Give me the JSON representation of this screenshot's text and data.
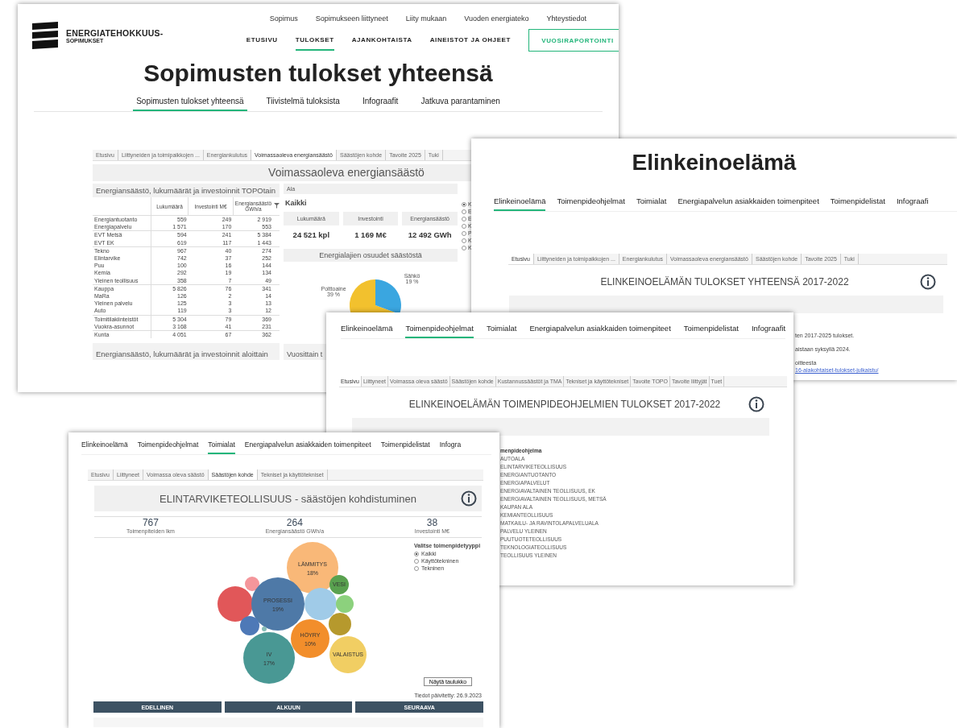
{
  "results_page": {
    "logo": {
      "line1": "ENERGIATEHOKKUUS-",
      "line2": "SOPIMUKSET"
    },
    "top_links": [
      "Sopimus",
      "Sopimukseen liittyneet",
      "Liity mukaan",
      "Vuoden energiateko",
      "Yhteystiedot"
    ],
    "main_nav": [
      {
        "label": "ETUSIVU",
        "selected": false
      },
      {
        "label": "TULOKSET",
        "selected": true
      },
      {
        "label": "AJANKOHTAISTA",
        "selected": false
      },
      {
        "label": "AINEISTOT JA OHJEET",
        "selected": false
      }
    ],
    "report_button": "VUOSIRAPORTOINTI",
    "title": "Sopimusten tulokset yhteensä",
    "sub_tabs": [
      {
        "label": "Sopimusten tulokset yhteensä",
        "selected": true
      },
      {
        "label": "Tiivistelmä tuloksista",
        "selected": false
      },
      {
        "label": "Infograafit",
        "selected": false
      },
      {
        "label": "Jatkuva parantaminen",
        "selected": false
      }
    ],
    "dashboard": {
      "tabs": [
        {
          "label": "Etusivu",
          "selected": false
        },
        {
          "label": "Liittyneiden ja toimipaikkojen ...",
          "selected": false
        },
        {
          "label": "Energiankulutus",
          "selected": false
        },
        {
          "label": "Voimassaoleva energiansäästö",
          "selected": true
        },
        {
          "label": "Säästöjen kohde",
          "selected": false
        },
        {
          "label": "Tavoite 2025",
          "selected": false
        },
        {
          "label": "Tuki",
          "selected": false
        }
      ],
      "title": "Voimassaoleva energiansäästö",
      "table": {
        "title": "Energiansäästö, lukumäärät ja investoinnit TOPOtain",
        "columns": [
          "Lukumäärä",
          "Investointi M€",
          "Energiansäästö GWh/a"
        ],
        "groups": [
          [
            {
              "name": "Energiantuotanto",
              "values": [
                "559",
                "249",
                "2 919"
              ]
            },
            {
              "name": "Energiapalvelu",
              "values": [
                "1 571",
                "170",
                "553"
              ]
            }
          ],
          [
            {
              "name": "EVT Metsä",
              "values": [
                "594",
                "241",
                "5 384"
              ]
            },
            {
              "name": "EVT EK",
              "values": [
                "619",
                "117",
                "1 443"
              ]
            }
          ],
          [
            {
              "name": "Tekno",
              "values": [
                "967",
                "40",
                "274"
              ]
            },
            {
              "name": "Elintarvike",
              "values": [
                "742",
                "37",
                "252"
              ]
            },
            {
              "name": "Puu",
              "values": [
                "100",
                "16",
                "144"
              ]
            },
            {
              "name": "Kemia",
              "values": [
                "292",
                "19",
                "134"
              ]
            },
            {
              "name": "Yleinen teollisuus",
              "values": [
                "358",
                "7",
                "49"
              ]
            }
          ],
          [
            {
              "name": "Kauppa",
              "values": [
                "5 826",
                "76",
                "341"
              ]
            },
            {
              "name": "MaRa",
              "values": [
                "126",
                "2",
                "14"
              ]
            },
            {
              "name": "Yleinen palvelu",
              "values": [
                "125",
                "3",
                "13"
              ]
            },
            {
              "name": "Auto",
              "values": [
                "119",
                "3",
                "12"
              ]
            }
          ],
          [
            {
              "name": "Toimitilakiinteistöt",
              "values": [
                "5 304",
                "79",
                "369"
              ]
            },
            {
              "name": "Vuokra-asunnot",
              "values": [
                "3 168",
                "41",
                "231"
              ]
            }
          ],
          [
            {
              "name": "Kunta",
              "values": [
                "4 051",
                "67",
                "362"
              ]
            }
          ]
        ]
      },
      "filter_label": "Ala",
      "filter_value": "Kaikki",
      "kpis": [
        {
          "label": "Lukumäärä",
          "value": "24 521 kpl"
        },
        {
          "label": "Investointi",
          "value": "1 169 M€"
        },
        {
          "label": "Energiansäästö",
          "value": "12 492 GWh"
        }
      ],
      "share_title": "Energialajien osuudet säästöstä",
      "shares": [
        {
          "label": "Polttoaine",
          "pct": "39 %",
          "color": "#f2c12e"
        },
        {
          "label": "Sähkö",
          "pct": "19 %",
          "color": "#3aa6e0"
        }
      ],
      "radios": [
        {
          "label": "K",
          "selected": true
        },
        {
          "label": "E",
          "selected": false
        },
        {
          "label": "E",
          "selected": false
        },
        {
          "label": "K",
          "selected": false
        },
        {
          "label": "P",
          "selected": false
        },
        {
          "label": "K",
          "selected": false
        },
        {
          "label": "K",
          "selected": false
        }
      ],
      "bottom_titles": [
        "Energiansäästö, lukumäärät ja investoinnit aloittain",
        "Vuosittain t"
      ]
    }
  },
  "business_page": {
    "title": "Elinkeinoelämä",
    "tabs": [
      {
        "label": "Elinkeinoelämä",
        "selected": true
      },
      {
        "label": "Toimenpideohjelmat",
        "selected": false
      },
      {
        "label": "Toimialat",
        "selected": false
      },
      {
        "label": "Energiapalvelun asiakkaiden toimenpiteet",
        "selected": false
      },
      {
        "label": "Toimenpidelistat",
        "selected": false
      },
      {
        "label": "Infograafi",
        "selected": false
      }
    ],
    "dashboard_tabs": [
      {
        "label": "Etusivu",
        "selected": true
      },
      {
        "label": "Liittyneiden ja toimipaikkojen ...",
        "selected": false
      },
      {
        "label": "Energiankulutus",
        "selected": false
      },
      {
        "label": "Voimassaoleva energiansäästö",
        "selected": false
      },
      {
        "label": "Säästöjen kohde",
        "selected": false
      },
      {
        "label": "Tavoite 2025",
        "selected": false
      },
      {
        "label": "Tuki",
        "selected": false
      }
    ],
    "dashboard_title": "ELINKEINOELÄMÄN TULOKSET YHTEENSÄ 2017-2022",
    "text_fragments": [
      "ten 2017-2025 tulokset.",
      "aistaan syksyllä 2024.",
      "oitteesta"
    ],
    "link_fragment": "16-alakohtaiset-tulokset-julkaistu/"
  },
  "programs_page": {
    "tabs": [
      {
        "label": "Elinkeinoelämä",
        "selected": false
      },
      {
        "label": "Toimenpideohjelmat",
        "selected": true
      },
      {
        "label": "Toimialat",
        "selected": false
      },
      {
        "label": "Energiapalvelun asiakkaiden toimenpiteet",
        "selected": false
      },
      {
        "label": "Toimenpidelistat",
        "selected": false
      },
      {
        "label": "Infograafit",
        "selected": false
      }
    ],
    "dashboard_tabs": [
      {
        "label": "Etusivu",
        "selected": true
      },
      {
        "label": "Liittyneet",
        "selected": false
      },
      {
        "label": "Voimassa oleva säästö",
        "selected": false
      },
      {
        "label": "Säästöjen kohde",
        "selected": false
      },
      {
        "label": "Kustannussäästöt ja TMA",
        "selected": false
      },
      {
        "label": "Tekniset ja käyttötekniset",
        "selected": false
      },
      {
        "label": "Tavoite TOPO",
        "selected": false
      },
      {
        "label": "Tavoite liittyjät",
        "selected": false
      },
      {
        "label": "Tuet",
        "selected": false
      }
    ],
    "dashboard_title": "ELINKEINOELÄMÄN TOIMENPIDEOHJELMIEN TULOKSET 2017-2022",
    "list_heading": "menpideohjelma",
    "programs": [
      "AUTOALA",
      "ELINTARVIKETEOLLISUUS",
      "ENERGIANTUOTANTO",
      "ENERGIAPALVELUT",
      "ENERGIAVALTAINEN TEOLLISUUS, EK",
      "ENERGIAVALTAINEN TEOLLISUUS, METSÄ",
      "KAUPAN ALA",
      "KEMIANTEOLLISUUS",
      "MATKAILU- JA RAVINTOLAPALVELUALA",
      "PALVELU YLEINEN",
      "PUUTUOTETEOLLISUUS",
      "TEKNOLOGIATEOLLISUUS",
      "TEOLLISUUS YLEINEN"
    ]
  },
  "food_industry_page": {
    "tabs": [
      {
        "label": "Elinkeinoelämä",
        "selected": false
      },
      {
        "label": "Toimenpideohjelmat",
        "selected": false
      },
      {
        "label": "Toimialat",
        "selected": true
      },
      {
        "label": "Energiapalvelun asiakkaiden toimenpiteet",
        "selected": false
      },
      {
        "label": "Toimenpidelistat",
        "selected": false
      },
      {
        "label": "Infogra",
        "selected": false
      }
    ],
    "dashboard_tabs": [
      {
        "label": "Etusivu",
        "selected": false
      },
      {
        "label": "Liittyneet",
        "selected": false
      },
      {
        "label": "Voimassa oleva säästö",
        "selected": false
      },
      {
        "label": "Säästöjen kohde",
        "selected": true
      },
      {
        "label": "Tekniset ja käyttötekniset",
        "selected": false
      }
    ],
    "title": "ELINTARVIKETEOLLISUUS - säästöjen kohdistuminen",
    "kpis": [
      {
        "value": "767",
        "label": "Toimenpiteiden lkm"
      },
      {
        "value": "264",
        "label": "Energiansäästö GWh/a"
      },
      {
        "value": "38",
        "label": "Investointi M€"
      }
    ],
    "filter": {
      "title": "Valitse toimenpidetyyppi",
      "options": [
        {
          "label": "Kaikki",
          "selected": true
        },
        {
          "label": "Käyttötekninen",
          "selected": false
        },
        {
          "label": "Tekninen",
          "selected": false
        }
      ]
    },
    "bubbles": [
      {
        "label": "LÄMMITYS",
        "share": "18%",
        "color": "#f9b878"
      },
      {
        "color": "#f4969b"
      },
      {
        "color": "#e15759"
      },
      {
        "label": "PROSESSI",
        "share": "19%",
        "color": "#4e79a7"
      },
      {
        "color": "#a0cbe8"
      },
      {
        "label": "VESI",
        "color": "#59a14f"
      },
      {
        "color": "#8cd17d"
      },
      {
        "color": "#b6992d"
      },
      {
        "color": "#4e79b7"
      },
      {
        "color": "#86bcb6"
      },
      {
        "label": "HÖYRY",
        "share": "10%",
        "color": "#f28e2b"
      },
      {
        "label": "IV",
        "share": "17%",
        "color": "#499894"
      },
      {
        "label": "VALAISTUS",
        "color": "#f1ce63"
      }
    ],
    "table_button": "Näytä taulukko",
    "updated": "Tiedot päivitetty: 26.9.2023",
    "nav_buttons": [
      "EDELLINEN",
      "ALKUUN",
      "SEURAAVA"
    ]
  }
}
